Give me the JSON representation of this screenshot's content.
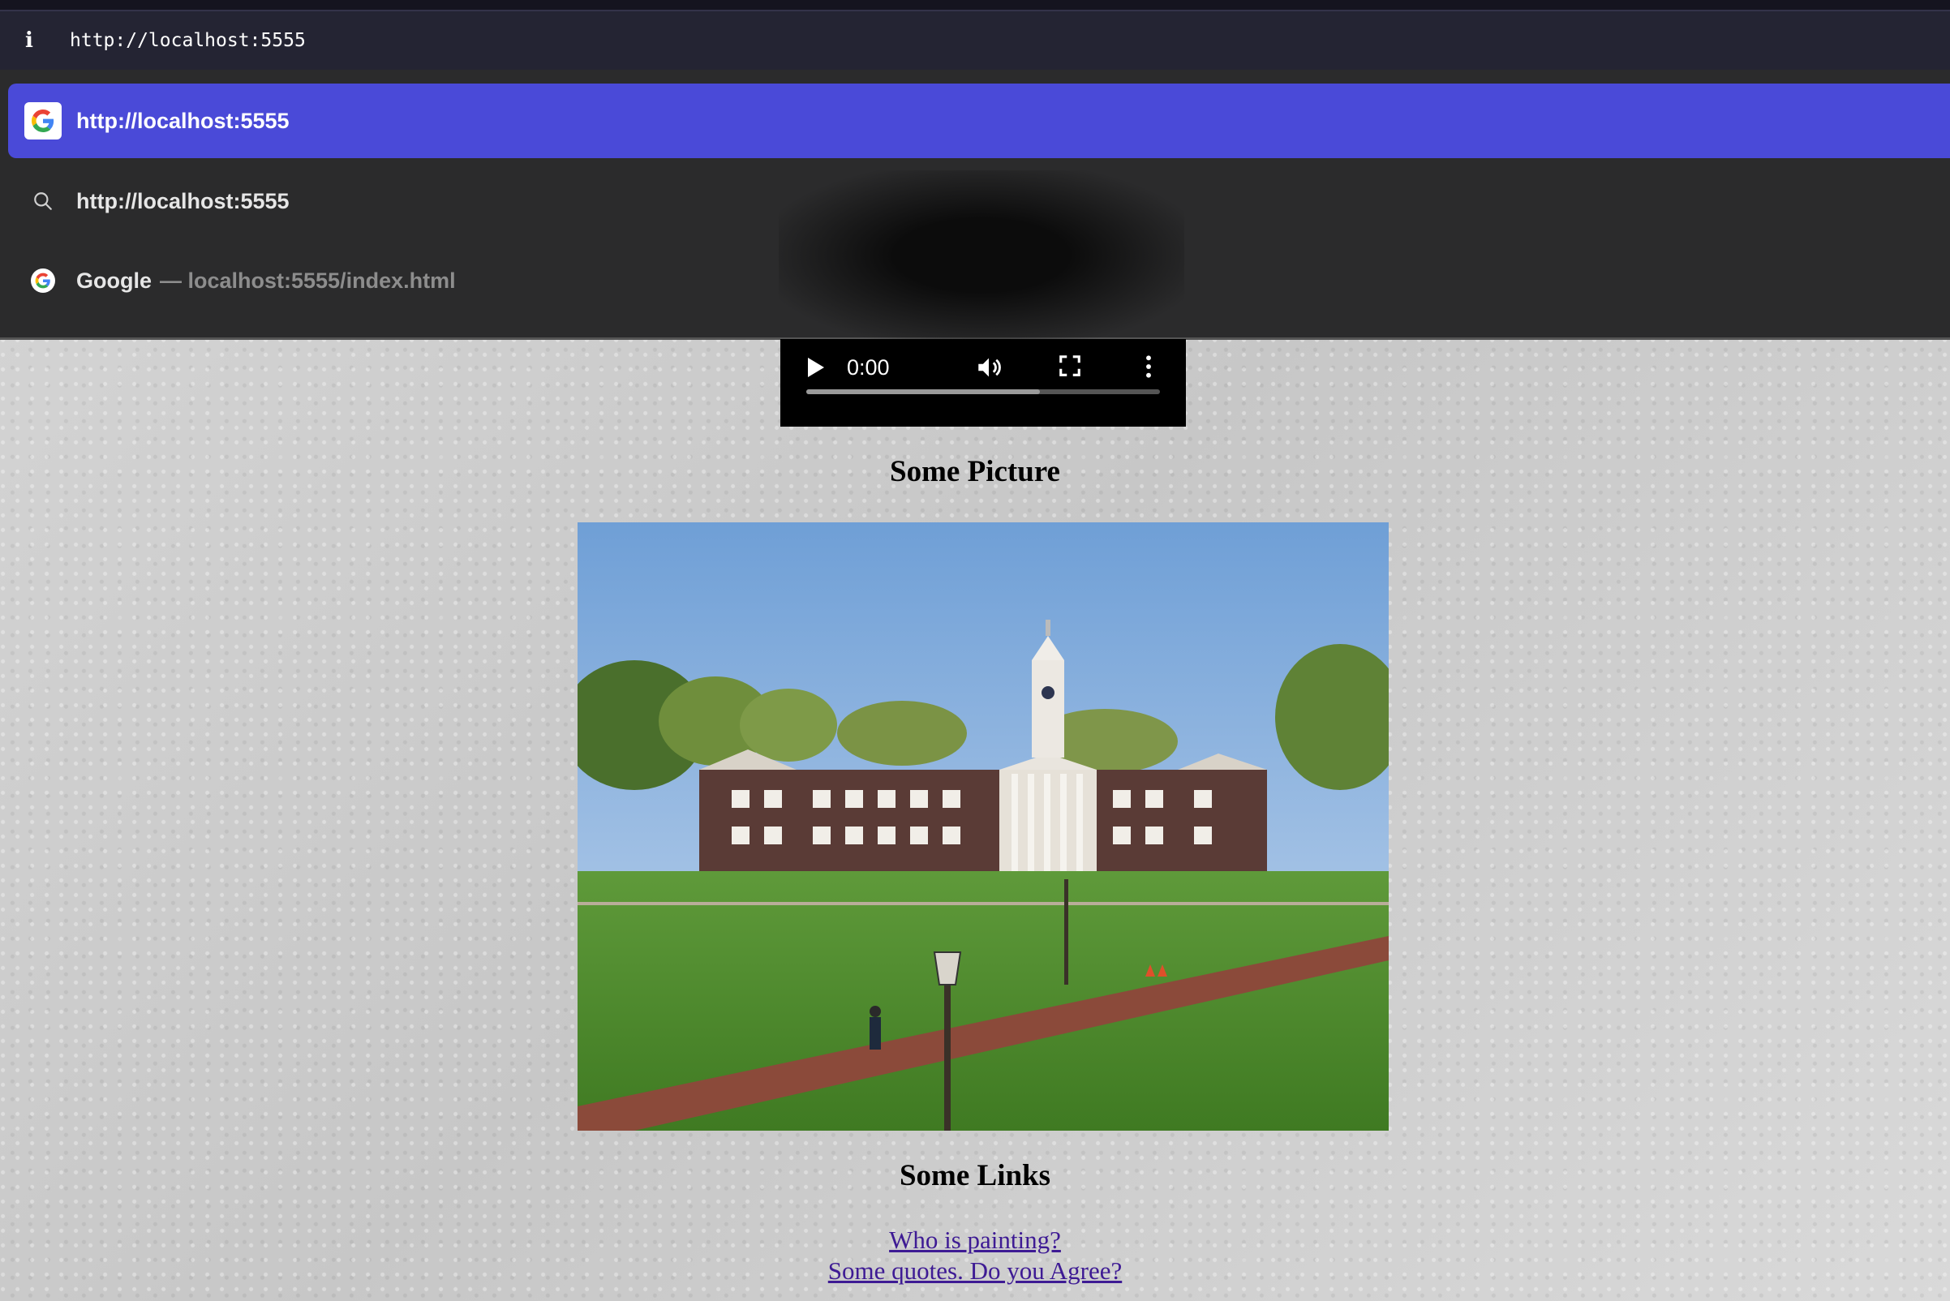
{
  "browser": {
    "address_bar": {
      "text": "http://localhost:5555"
    },
    "suggestions": [
      {
        "label": "http://localhost:5555",
        "icon": "google-g-icon",
        "selected": true
      },
      {
        "label": "http://localhost:5555",
        "icon": "search-icon",
        "selected": false
      },
      {
        "label": "Google",
        "subtext": "— localhost:5555/index.html",
        "icon": "google-g-icon",
        "selected": false
      }
    ],
    "colors": {
      "selected_row": "#4a4ad8",
      "dropdown_bg": "#2b2b2c"
    }
  },
  "video_player": {
    "time": "0:00",
    "buffered_fraction": 0.66
  },
  "page": {
    "picture_heading": "Some Picture",
    "links_heading": "Some Links",
    "links": [
      "Who is painting?",
      "Some quotes. Do you Agree?"
    ],
    "link_color": "#3e1b94"
  }
}
